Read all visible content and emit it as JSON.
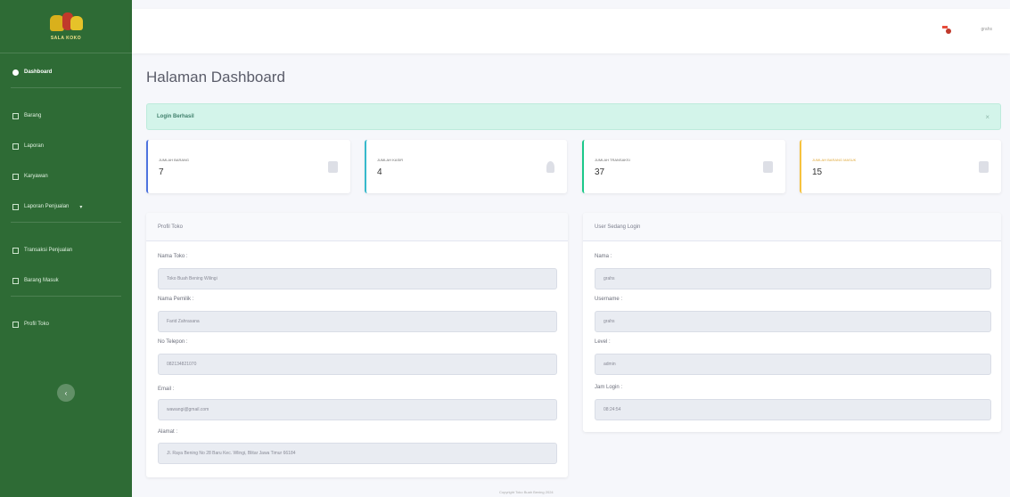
{
  "sidebar": {
    "brand": "SALA KOKO",
    "items": [
      {
        "label": "Dashboard"
      },
      {
        "label": "Barang"
      },
      {
        "label": "Laporan"
      },
      {
        "label": "Karyawan"
      },
      {
        "label": "Laporan Penjualan"
      },
      {
        "label": "Transaksi Penjualan"
      },
      {
        "label": "Barang Masuk"
      },
      {
        "label": "Profil Toko"
      }
    ]
  },
  "topbar": {
    "user": "grahs"
  },
  "page": {
    "title": "Halaman Dashboard"
  },
  "alert": {
    "text": "Login Berhasil",
    "close": "×"
  },
  "stats": [
    {
      "label": "Jumlah Barang",
      "value": "7"
    },
    {
      "label": "Jumlah Kasir",
      "value": "4"
    },
    {
      "label": "Jumlah Transaksi",
      "value": "37"
    },
    {
      "label": "Jumlah Barang Masuk",
      "value": "15"
    }
  ],
  "profil": {
    "title": "Profil Toko",
    "fields": [
      {
        "label": "Nama Toko :",
        "value": "Toko Buah Bening Wilingi"
      },
      {
        "label": "Nama Pemilik :",
        "value": "Farid Zahrasana"
      },
      {
        "label": "No Telepon :",
        "value": "082134821070"
      },
      {
        "label": "Email :",
        "value": "wawangi@gmail.com"
      },
      {
        "label": "Alamat :",
        "value": "Jl. Raya Bening No 28 Baru Kec. Wlingi, Blitar Jawa Timur 66184"
      }
    ]
  },
  "user": {
    "title": "User Sedang Login",
    "fields": [
      {
        "label": "Nama :",
        "value": "grahs"
      },
      {
        "label": "Username :",
        "value": "grahs"
      },
      {
        "label": "Level :",
        "value": "admin"
      },
      {
        "label": "Jam Login :",
        "value": "08:24:54"
      }
    ]
  },
  "footer": {
    "text": "Copyright Toko Buah Bening 2024"
  },
  "colors": {
    "sidebar": "#2e6b35",
    "alert": "#d3f4ea",
    "stat_borders": [
      "#4e73df",
      "#36b9cc",
      "#1cc88a",
      "#f6c23e"
    ]
  }
}
